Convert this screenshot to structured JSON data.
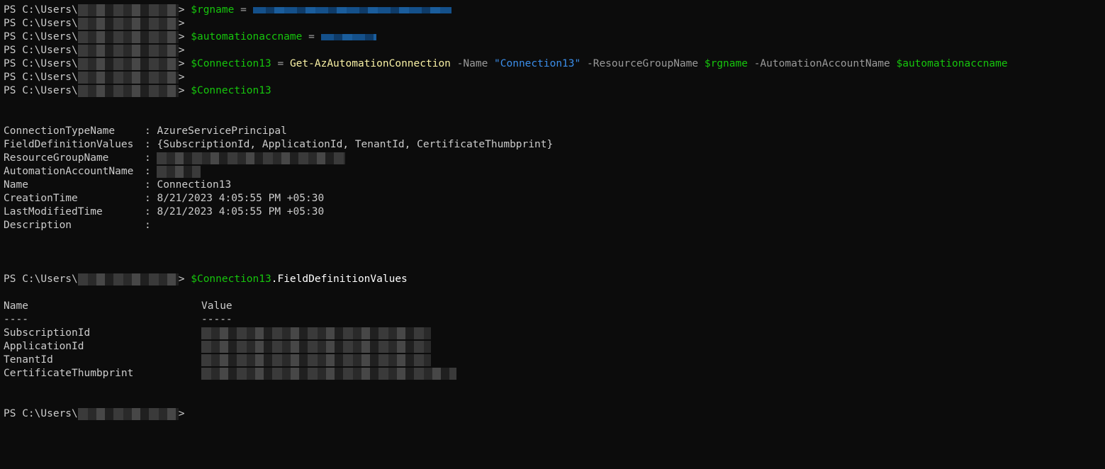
{
  "prompt": "PS C:\\Users\\",
  "prompt_end": ">",
  "cmds": {
    "c1": {
      "var": "$rgname",
      "op": " = "
    },
    "c3": {
      "var": "$automationaccname",
      "op": " = "
    },
    "c5": {
      "var": "$Connection13",
      "op": " = ",
      "cmd": "Get-AzAutomationConnection",
      "p1": " -Name ",
      "s1": "\"Connection13\"",
      "p2": " -ResourceGroupName ",
      "v2": "$rgname",
      "p3": " -AutomationAccountName ",
      "v3": "$automationaccname"
    },
    "c7": {
      "var": "$Connection13"
    },
    "c8": {
      "var": "$Connection13",
      "member": ".FieldDefinitionValues"
    }
  },
  "output": [
    {
      "key": "ConnectionTypeName",
      "sep": ": ",
      "value": "AzureServicePrincipal"
    },
    {
      "key": "FieldDefinitionValues",
      "sep": ": ",
      "value": "{SubscriptionId, ApplicationId, TenantId, CertificateThumbprint}"
    },
    {
      "key": "ResourceGroupName",
      "sep": ": ",
      "value": ""
    },
    {
      "key": "AutomationAccountName",
      "sep": ": ",
      "value": ""
    },
    {
      "key": "Name",
      "sep": ": ",
      "value": "Connection13"
    },
    {
      "key": "CreationTime",
      "sep": ": ",
      "value": "8/21/2023 4:05:55 PM +05:30"
    },
    {
      "key": "LastModifiedTime",
      "sep": ": ",
      "value": "8/21/2023 4:05:55 PM +05:30"
    },
    {
      "key": "Description",
      "sep": ": ",
      "value": ""
    }
  ],
  "table": {
    "headers": [
      "Name",
      "Value"
    ],
    "underlines": [
      "----",
      "-----"
    ],
    "rows": [
      "SubscriptionId",
      "ApplicationId",
      "TenantId",
      "CertificateThumbprint"
    ]
  },
  "colors": {
    "background": "#0c0c0c",
    "text": "#cccccc",
    "variable": "#16c60c",
    "command": "#f9f1a5",
    "parameter": "#9a9a9a",
    "string": "#3b8eea"
  }
}
